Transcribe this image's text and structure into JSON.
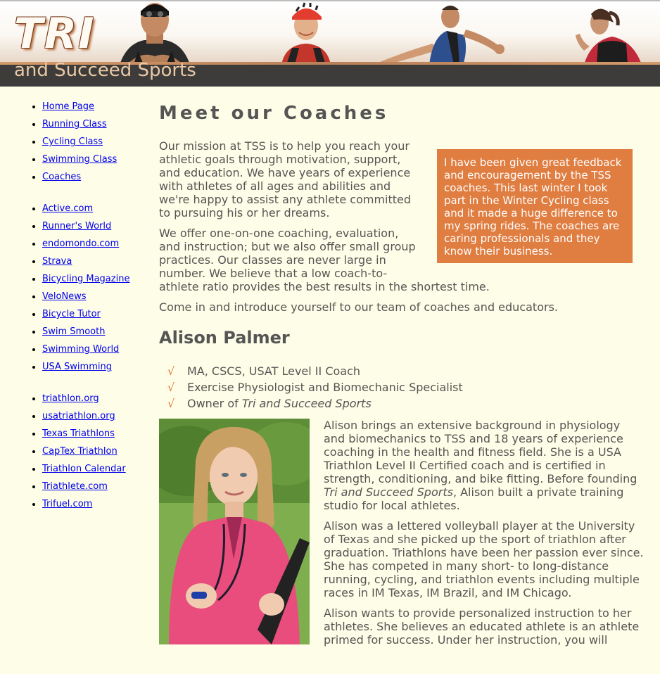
{
  "header": {
    "logo_main": "TRI",
    "logo_sub": "and Succeed Sports"
  },
  "sidebar": {
    "groups": [
      {
        "items": [
          {
            "label": "Home Page"
          },
          {
            "label": "Running Class"
          },
          {
            "label": "Cycling Class"
          },
          {
            "label": "Swimming Class"
          },
          {
            "label": "Coaches"
          }
        ]
      },
      {
        "items": [
          {
            "label": "Active.com"
          },
          {
            "label": "Runner's World"
          },
          {
            "label": "endomondo.com"
          },
          {
            "label": "Strava"
          },
          {
            "label": "Bicycling Magazine"
          },
          {
            "label": "VeloNews"
          },
          {
            "label": "Bicycle Tutor"
          },
          {
            "label": "Swim Smooth"
          },
          {
            "label": "Swimming World"
          },
          {
            "label": "USA Swimming"
          }
        ]
      },
      {
        "items": [
          {
            "label": "triathlon.org"
          },
          {
            "label": "usatriathlon.org"
          },
          {
            "label": "Texas Triathlons"
          },
          {
            "label": "CapTex Triathlon"
          },
          {
            "label": "Triathlon Calendar"
          },
          {
            "label": "Triathlete.com"
          },
          {
            "label": "Trifuel.com"
          }
        ]
      }
    ]
  },
  "main": {
    "title": "Meet our Coaches",
    "quote": "I have been given great feedback and encouragement by the TSS coaches. This last winter I took part in the Winter Cycling class and it made a huge difference to my spring rides. The coaches are caring professionals and they know their business.",
    "intro": [
      "Our mission at TSS is to help you reach your athletic goals through motivation, support, and education. We have years of experience with athletes of all ages and abilities and we're happy to assist any athlete committed to pursuing his or her dreams.",
      "We offer one-on-one coaching, evaluation, and instruction; but we also offer small group practices. Our classes are never large in number. We believe that a low coach-to-athlete ratio provides the best results in the shortest time.",
      "Come in and introduce yourself to our team of coaches and educators."
    ],
    "coach": {
      "name": "Alison Palmer",
      "check_glyph": "√",
      "cred1": "MA, CSCS, USAT Level II Coach",
      "cred2": "Exercise Physiologist and Biomechanic Specialist",
      "cred3_pre": "Owner of ",
      "cred3_em": "Tri and Succeed Sports",
      "bio1_pre": "Alison brings an extensive background in physiology and biomechanics to TSS and 18 years of experience coaching in the health and fitness field. She is a USA Triathlon Level II Certified coach and is certified in strength, conditioning, and bike fitting. Before founding ",
      "bio1_em": "Tri and Succeed Sports",
      "bio1_post": ", Alison built a private training studio for local athletes.",
      "bio2": "Alison was a lettered volleyball player at the University of Texas and she picked up the sport of triathlon after graduation. Triathlons have been her passion ever since. She has competed in many short- to long-distance running, cycling, and triathlon events including multiple races in IM Texas, IM Brazil, and IM Chicago.",
      "bio3": "Alison wants to provide personalized instruction to her athletes. She believes an educated athlete is an athlete primed for success. Under her instruction, you will"
    }
  },
  "colors": {
    "accent": "#e07d40",
    "background": "#fefde7",
    "header_bar": "#3e3c3a",
    "link": "#0000ee"
  }
}
